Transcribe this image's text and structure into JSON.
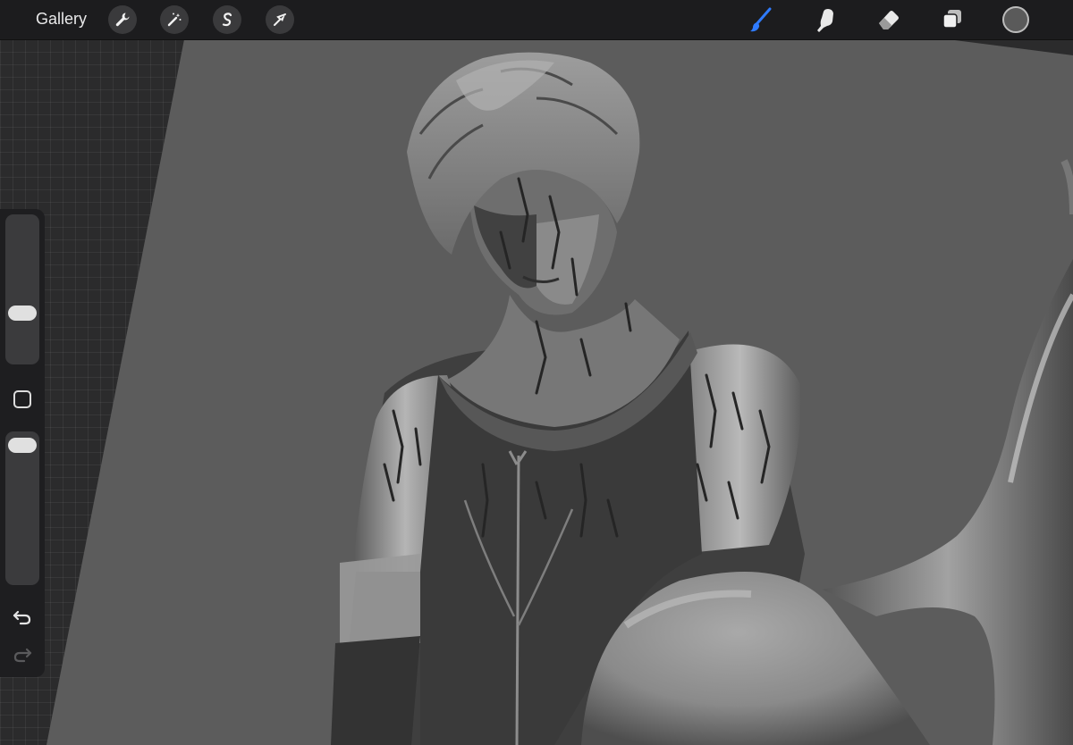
{
  "topbar": {
    "gallery_label": "Gallery",
    "left_tools": [
      {
        "name": "actions",
        "icon": "wrench-icon"
      },
      {
        "name": "adjustments",
        "icon": "magic-wand-icon"
      },
      {
        "name": "selection",
        "icon": "selection-s-icon"
      },
      {
        "name": "transform",
        "icon": "arrow-cursor-icon"
      }
    ],
    "right_tools": [
      {
        "name": "brush",
        "icon": "brush-icon",
        "active": true
      },
      {
        "name": "smudge",
        "icon": "smudge-finger-icon",
        "active": false
      },
      {
        "name": "eraser",
        "icon": "eraser-icon",
        "active": false
      },
      {
        "name": "layers",
        "icon": "layers-icon",
        "active": false
      }
    ],
    "current_color": "#5a5a5a",
    "active_color": "#2f7bff"
  },
  "sidebar": {
    "brush_size_level": 0.32,
    "opacity_level": 0.97,
    "modifier_icon": "square-icon",
    "undo_icon": "undo-arrow-icon",
    "redo_icon": "redo-arrow-icon"
  },
  "canvas": {
    "background_color": "#5c5c5c",
    "artwork": "greyscale-figure-painting"
  }
}
